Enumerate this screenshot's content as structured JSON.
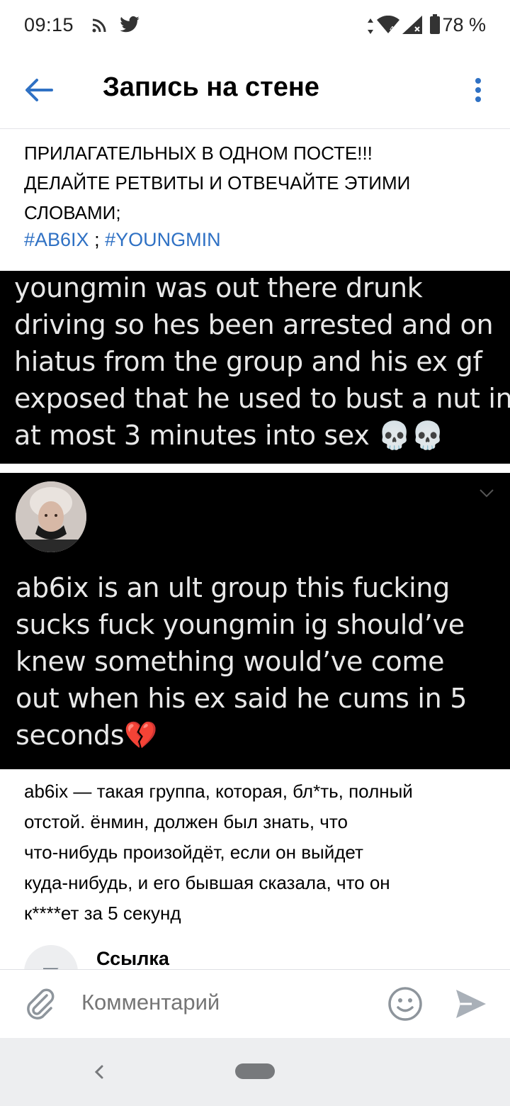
{
  "status_bar": {
    "time": "09:15",
    "battery": "78 %",
    "icons": [
      "rss-icon",
      "twitter-icon",
      "data-arrows-icon",
      "wifi-icon",
      "signal-icon",
      "battery-icon"
    ]
  },
  "header": {
    "title": "Запись на стене",
    "back_icon": "arrow-left-icon",
    "more_icon": "more-vertical-icon"
  },
  "post": {
    "text_lines": [
      "ПРИЛАГАТЕЛЬНЫХ В ОДНОМ ПОСТЕ!!!",
      "ДЕЛАЙТЕ РЕТВИТЫ И ОТВЕЧАЙТЕ ЭТИМИ",
      "СЛОВАМИ;"
    ],
    "hashtag_1": "#AB6IX",
    "hashtag_separator": " ; ",
    "hashtag_2": "#YOUNGMIN"
  },
  "tweet_1": {
    "lines": [
      "youngmin was out there drunk",
      "driving so hes been arrested and on",
      "hiatus from the group and his ex gf",
      "exposed that he used to bust a nut in",
      "at most 3 minutes into sex 💀💀"
    ]
  },
  "tweet_2": {
    "lines": [
      "ab6ix is an ult group this fucking",
      "sucks fuck youngmin ig should’ve",
      "knew something would’ve come",
      "out when his ex said he cums in 5",
      "seconds💔"
    ]
  },
  "translation": {
    "lines": [
      "ab6ix — такая группа, которая, бл*ть, полный",
      "отстой. ёнмин, должен был знать, что",
      "что-нибудь произойдёт, если он выйдет",
      "куда-нибудь, и его бывшая сказала, что он",
      "к****ет за 5 секунд"
    ]
  },
  "link": {
    "title": "Ссылка",
    "icon": "link-icon"
  },
  "comment_bar": {
    "placeholder": "Комментарий",
    "attach_icon": "paperclip-icon",
    "emoji_icon": "smile-icon",
    "send_icon": "send-icon"
  },
  "nav_bar": {
    "back_icon": "nav-back-icon",
    "home_icon": "nav-home-pill"
  },
  "colors": {
    "accent": "#2f71c4",
    "hashtag": "#2f71c4",
    "tweet_bg": "#000000",
    "tweet_text": "#e8e8e8",
    "placeholder": "#8e959c",
    "nav_bar_bg": "#edeef0"
  }
}
